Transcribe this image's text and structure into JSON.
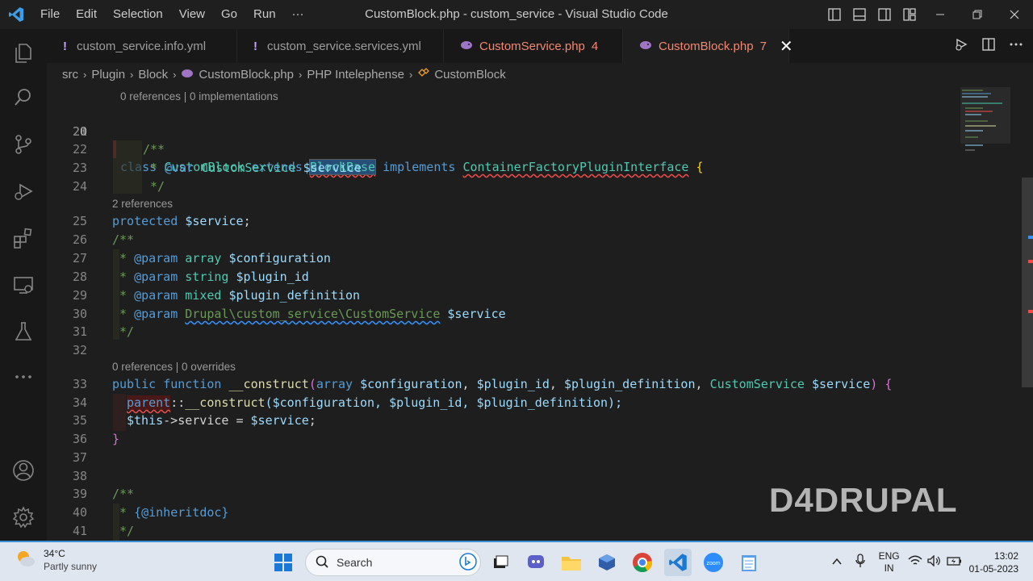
{
  "window": {
    "title": "CustomBlock.php - custom_service - Visual Studio Code",
    "menu": [
      "File",
      "Edit",
      "Selection",
      "View",
      "Go",
      "Run",
      "···"
    ]
  },
  "tabs": [
    {
      "label": "custom_service.info.yml",
      "prefix": "!",
      "count": ""
    },
    {
      "label": "custom_service.services.yml",
      "prefix": "!",
      "count": ""
    },
    {
      "label": "CustomService.php",
      "prefix": "php",
      "count": "4"
    },
    {
      "label": "CustomBlock.php",
      "prefix": "php",
      "count": "7",
      "active": true
    }
  ],
  "breadcrumb": [
    "src",
    "Plugin",
    "Block",
    "CustomBlock.php",
    "PHP Intelephense",
    "CustomBlock"
  ],
  "codelens": {
    "l20": "0 references | 0 implementations",
    "l25": "2 references",
    "l33": "0 references | 0 overrides"
  },
  "line_numbers": [
    "20",
    "21",
    "22",
    "23",
    "24",
    "25",
    "26",
    "27",
    "28",
    "29",
    "30",
    "31",
    "32",
    "33",
    "34",
    "35",
    "36",
    "37",
    "38",
    "39",
    "40",
    "41"
  ],
  "code": {
    "l20": {
      "kw1": "class",
      "name": "CustomBlock",
      "kw2": "extends",
      "base": "BlockBase",
      "kw3": "implements",
      "iface": "ContainerFactoryPluginInterface",
      "brace": "{"
    },
    "l22": "/**",
    "l23": {
      "star": "* ",
      "tag": "@var",
      "type": "CustomService",
      "var": "$service"
    },
    "l24": "*/",
    "l25": {
      "kw": "protected",
      "var": "$service",
      "end": ";"
    },
    "l26": "/**",
    "l27": {
      "star": "* ",
      "tag": "@param",
      "type": "array",
      "var": "$configuration"
    },
    "l28": {
      "star": "* ",
      "tag": "@param",
      "type": "string",
      "var": "$plugin_id"
    },
    "l29": {
      "star": "* ",
      "tag": "@param",
      "type": "mixed",
      "var": "$plugin_definition"
    },
    "l30": {
      "star": "* ",
      "tag": "@param",
      "type": "Drupal\\custom_service\\CustomService",
      "var": "$service"
    },
    "l31": "*/",
    "l33": {
      "kw1": "public",
      "kw2": "function",
      "fn": "__construct",
      "p_open": "(",
      "t1": "array",
      "v1": "$configuration",
      "v2": "$plugin_id",
      "v3": "$plugin_definition",
      "t4": "CustomService",
      "v4": "$service",
      "p_close": ")",
      "brace": "{"
    },
    "l34": {
      "kw": "parent",
      "op": "::",
      "fn": "__construct",
      "args": "($configuration, $plugin_id, $plugin_definition);"
    },
    "l35": {
      "var": "$this",
      "arrow": "->service = ",
      "val": "$service",
      "end": ";"
    },
    "l36": "}",
    "l39": "/**",
    "l40": {
      "star": "* ",
      "tag": "{@inheritdoc}"
    },
    "l41": "*/"
  },
  "watermark": "D4DRUPAL",
  "taskbar": {
    "weather_temp": "34°C",
    "weather_desc": "Partly sunny",
    "search_placeholder": "Search",
    "lang_top": "ENG",
    "lang_bottom": "IN",
    "time": "13:02",
    "date": "01-05-2023"
  },
  "colors": {
    "accent": "#007acc",
    "error": "#f14c4c",
    "keyword": "#569cd6",
    "class": "#4ec9b0"
  }
}
